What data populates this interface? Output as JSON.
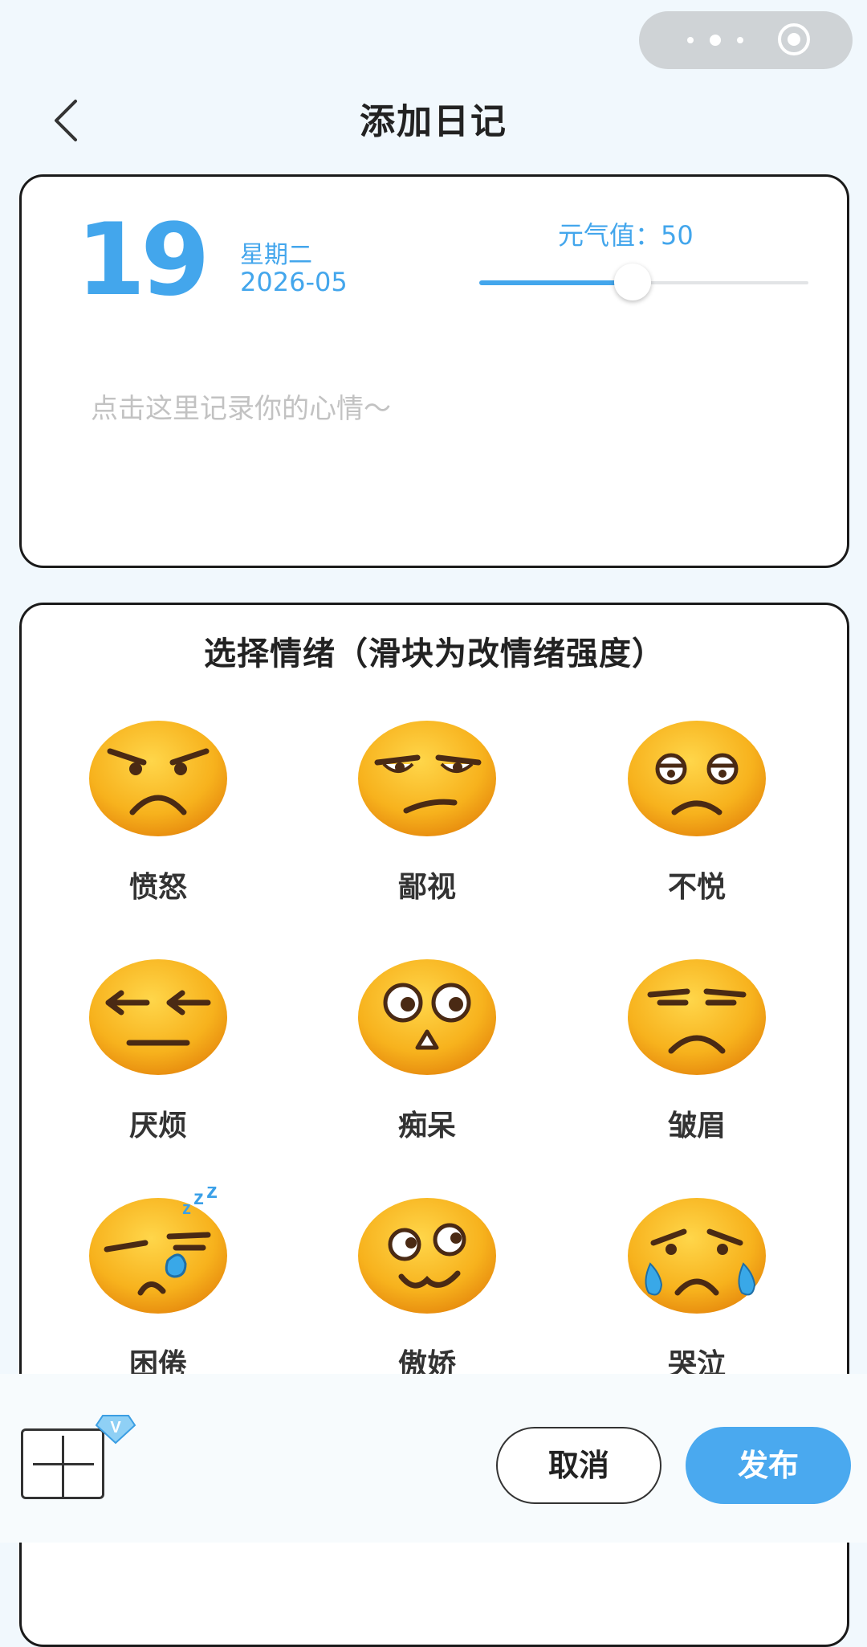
{
  "header": {
    "title": "添加日记",
    "back_icon": "chevron-left-icon"
  },
  "capsule": {
    "more_icon": "more-dots-icon",
    "close_icon": "target-icon"
  },
  "diary": {
    "day": "19",
    "weekday": "星期二",
    "year_month": "2026-05",
    "energy_label": "元气值：50",
    "energy_value": 50,
    "energy_max": 100,
    "mood_placeholder": "点击这里记录你的心情～",
    "accent_color": "#43a6ec"
  },
  "emotions": {
    "title": "选择情绪（滑块为改情绪强度）",
    "items": [
      {
        "label": "愤怒",
        "icon": "angry-face-icon"
      },
      {
        "label": "鄙视",
        "icon": "contempt-face-icon"
      },
      {
        "label": "不悦",
        "icon": "displeased-face-icon"
      },
      {
        "label": "厌烦",
        "icon": "annoyed-face-icon"
      },
      {
        "label": "痴呆",
        "icon": "dazed-face-icon"
      },
      {
        "label": "皱眉",
        "icon": "frown-face-icon"
      },
      {
        "label": "困倦",
        "icon": "sleepy-face-icon"
      },
      {
        "label": "傲娇",
        "icon": "proud-face-icon"
      },
      {
        "label": "哭泣",
        "icon": "crying-face-icon"
      }
    ]
  },
  "footer": {
    "add_icon": "add-image-icon",
    "badge_icon": "v-badge-icon",
    "cancel_label": "取消",
    "publish_label": "发布",
    "publish_color": "#4aa9ef"
  }
}
